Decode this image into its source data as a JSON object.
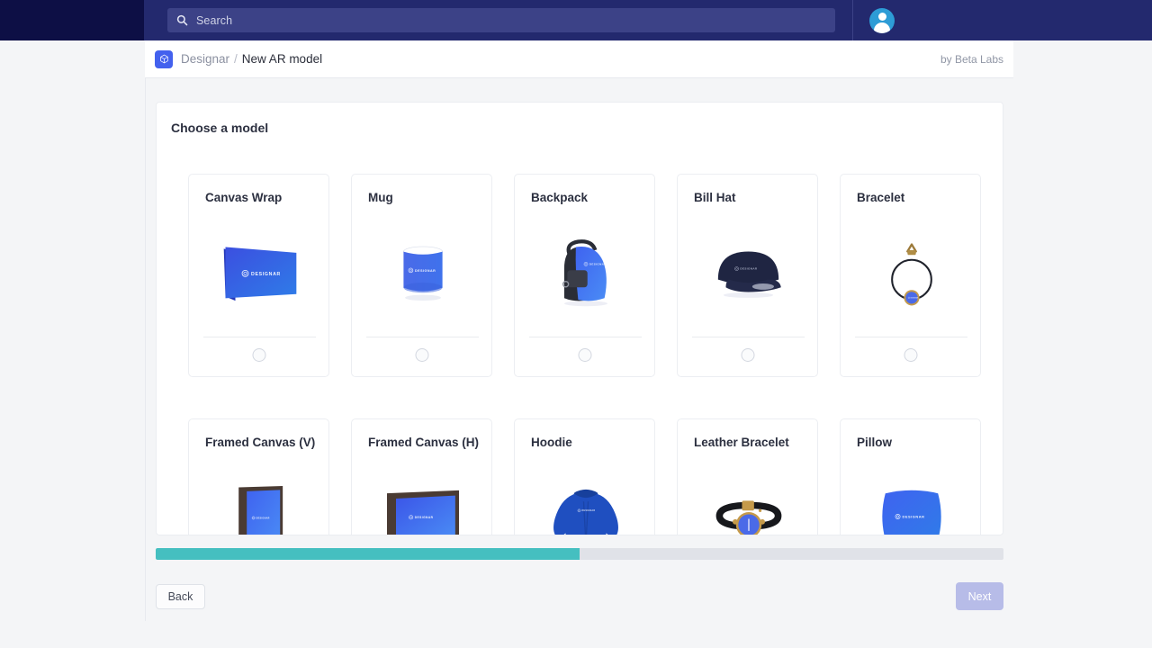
{
  "topbar": {
    "search": {
      "icon": "search-icon",
      "placeholder": "Search",
      "value": "Search"
    },
    "avatar": {
      "icon": "user-avatar-icon"
    },
    "colors": {
      "left_block": "#0d0f45",
      "main": "#23296e",
      "search_field": "#3c4287"
    }
  },
  "breadcrumb": {
    "logo_icon": "cube-logo-icon",
    "root": "Designar",
    "separator": "/",
    "current": "New AR model",
    "byline": "by Beta Labs"
  },
  "panel": {
    "title": "Choose a model",
    "models": [
      {
        "label": "Canvas Wrap",
        "art": "canvas-wrap-art",
        "selected": false
      },
      {
        "label": "Mug",
        "art": "mug-art",
        "selected": false
      },
      {
        "label": "Backpack",
        "art": "backpack-art",
        "selected": false
      },
      {
        "label": "Bill Hat",
        "art": "bill-hat-art",
        "selected": false
      },
      {
        "label": "Bracelet",
        "art": "bracelet-art",
        "selected": false
      },
      {
        "label": "Framed Canvas (V)",
        "art": "framed-canvas-v-art",
        "selected": false
      },
      {
        "label": "Framed Canvas (H)",
        "art": "framed-canvas-h-art",
        "selected": false
      },
      {
        "label": "Hoodie",
        "art": "hoodie-art",
        "selected": false
      },
      {
        "label": "Leather Bracelet",
        "art": "leather-bracelet-art",
        "selected": false
      },
      {
        "label": "Pillow",
        "art": "pillow-art",
        "selected": false
      }
    ],
    "brand_mark_text": "DESIGNAR"
  },
  "footer": {
    "progress_percent": 50,
    "progress_color": "#45bfc0",
    "back_label": "Back",
    "next_label": "Next",
    "next_disabled": true
  }
}
